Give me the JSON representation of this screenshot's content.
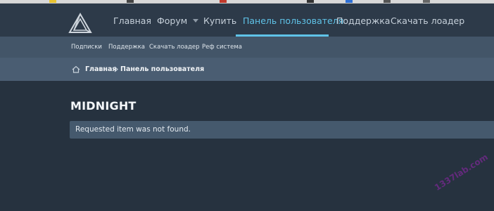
{
  "nav": {
    "items": [
      {
        "label": "Главная"
      },
      {
        "label": "Форум"
      },
      {
        "label": "Купить"
      },
      {
        "label": "Панель пользователя"
      },
      {
        "label": "Поддержка"
      },
      {
        "label": "Скачать лоадер"
      }
    ],
    "active": "Панель пользователя"
  },
  "subnav": {
    "items": [
      {
        "label": "Подписки"
      },
      {
        "label": "Поддержка"
      },
      {
        "label": "Скачать лоадер"
      },
      {
        "label": "Реф система"
      }
    ]
  },
  "breadcrumb": {
    "home": "Главная",
    "current": "Панель пользователя"
  },
  "page": {
    "title": "MIDNIGHT",
    "notice": "Requested item was not found."
  },
  "watermark": "1337lab.com",
  "colors": {
    "accent": "#5fc3e8",
    "header_bg": "#2d3a49",
    "subnav_bg": "#435568",
    "breadcrumb_bg": "#4a5d72",
    "body_bg": "#26323f",
    "notice_bg": "#45596d"
  }
}
